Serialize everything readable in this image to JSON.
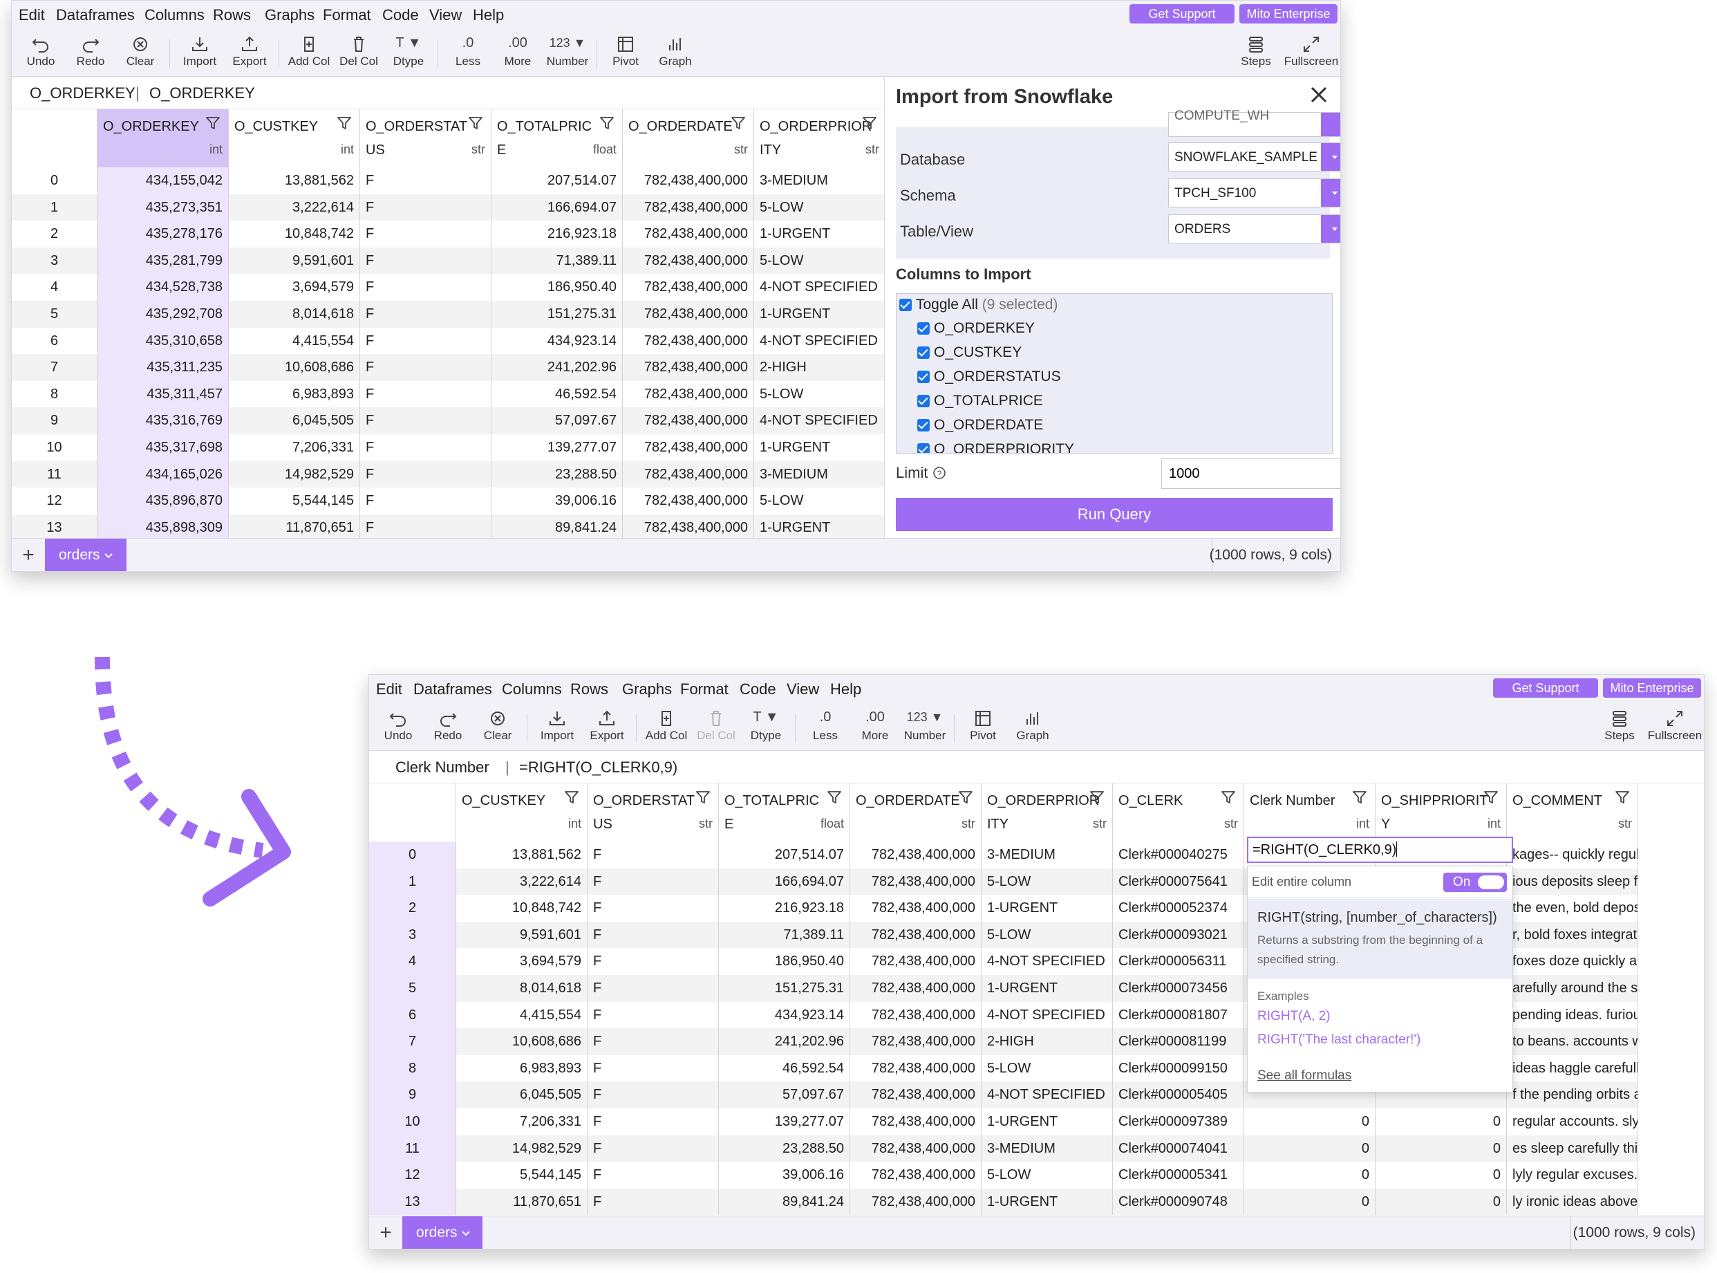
{
  "menu": [
    "Edit",
    "Dataframes",
    "Columns",
    "Rows",
    "Graphs",
    "Format",
    "Code",
    "View",
    "Help"
  ],
  "header_buttons": {
    "support": "Get Support",
    "enterprise": "Mito Enterprise"
  },
  "toolbar": {
    "undo": "Undo",
    "redo": "Redo",
    "clear": "Clear",
    "import": "Import",
    "export": "Export",
    "add_col": "Add Col",
    "del_col": "Del Col",
    "dtype": "Dtype",
    "dtype_glyph": "T ▼",
    "less": "Less",
    "less_glyph": ".0",
    "more": "More",
    "more_glyph": ".00",
    "number": "Number",
    "number_glyph": "123 ▼",
    "pivot": "Pivot",
    "graph": "Graph",
    "steps": "Steps",
    "fullscreen": "Fullscreen"
  },
  "top": {
    "formula_bar": {
      "column": "O_ORDERKEY",
      "separator": "|",
      "value": "O_ORDERKEY"
    },
    "columns": [
      {
        "name": "O_ORDERKEY",
        "type": "int"
      },
      {
        "name": "O_CUSTKEY",
        "type": "int"
      },
      {
        "name": "O_ORDERSTAT",
        "name2": "US",
        "type": "str"
      },
      {
        "name": "O_TOTALPRIC",
        "name2": "E",
        "type": "float"
      },
      {
        "name": "O_ORDERDATE",
        "type": "str"
      },
      {
        "name": "O_ORDERPRIOR",
        "name2": "ITY",
        "type": "str"
      }
    ],
    "rows": [
      [
        "0",
        "434,155,042",
        "13,881,562",
        "F",
        "207,514.07",
        "782,438,400,000",
        "3-MEDIUM"
      ],
      [
        "1",
        "435,273,351",
        "3,222,614",
        "F",
        "166,694.07",
        "782,438,400,000",
        "5-LOW"
      ],
      [
        "2",
        "435,278,176",
        "10,848,742",
        "F",
        "216,923.18",
        "782,438,400,000",
        "1-URGENT"
      ],
      [
        "3",
        "435,281,799",
        "9,591,601",
        "F",
        "71,389.11",
        "782,438,400,000",
        "5-LOW"
      ],
      [
        "4",
        "434,528,738",
        "3,694,579",
        "F",
        "186,950.40",
        "782,438,400,000",
        "4-NOT SPECIFIED"
      ],
      [
        "5",
        "435,292,708",
        "8,014,618",
        "F",
        "151,275.31",
        "782,438,400,000",
        "1-URGENT"
      ],
      [
        "6",
        "435,310,658",
        "4,415,554",
        "F",
        "434,923.14",
        "782,438,400,000",
        "4-NOT SPECIFIED"
      ],
      [
        "7",
        "435,311,235",
        "10,608,686",
        "F",
        "241,202.96",
        "782,438,400,000",
        "2-HIGH"
      ],
      [
        "8",
        "435,311,457",
        "6,983,893",
        "F",
        "46,592.54",
        "782,438,400,000",
        "5-LOW"
      ],
      [
        "9",
        "435,316,769",
        "6,045,505",
        "F",
        "57,097.67",
        "782,438,400,000",
        "4-NOT SPECIFIED"
      ],
      [
        "10",
        "435,317,698",
        "7,206,331",
        "F",
        "139,277.07",
        "782,438,400,000",
        "1-URGENT"
      ],
      [
        "11",
        "434,165,026",
        "14,982,529",
        "F",
        "23,288.50",
        "782,438,400,000",
        "3-MEDIUM"
      ],
      [
        "12",
        "435,896,870",
        "5,544,145",
        "F",
        "39,006.16",
        "782,438,400,000",
        "5-LOW"
      ],
      [
        "13",
        "435,898,309",
        "11,870,651",
        "F",
        "89,841.24",
        "782,438,400,000",
        "1-URGENT"
      ]
    ],
    "taskpane": {
      "title": "Import from Snowflake",
      "warehouse_partial": "COMPUTE_WH",
      "database_label": "Database",
      "database_value": "SNOWFLAKE_SAMPLE_",
      "schema_label": "Schema",
      "schema_value": "TPCH_SF100",
      "table_label": "Table/View",
      "table_value": "ORDERS",
      "columns_heading": "Columns to Import",
      "toggle_all": "Toggle All",
      "selected_count": "(9 selected)",
      "columns": [
        "O_ORDERKEY",
        "O_CUSTKEY",
        "O_ORDERSTATUS",
        "O_TOTALPRICE",
        "O_ORDERDATE",
        "O_ORDERPRIORITY"
      ],
      "limit_label": "Limit",
      "limit_value": "1000",
      "run_button": "Run Query"
    },
    "sheet_tab": "orders",
    "rows_info": "(1000 rows, 9 cols)"
  },
  "bottom": {
    "formula_bar": {
      "column": "Clerk Number",
      "separator": "|",
      "value": "=RIGHT(O_CLERK0,9)"
    },
    "columns": [
      {
        "name": "O_CUSTKEY",
        "type": "int"
      },
      {
        "name": "O_ORDERSTAT",
        "name2": "US",
        "type": "str"
      },
      {
        "name": "O_TOTALPRIC",
        "name2": "E",
        "type": "float"
      },
      {
        "name": "O_ORDERDATE",
        "type": "str"
      },
      {
        "name": "O_ORDERPRIOR",
        "name2": "ITY",
        "type": "str"
      },
      {
        "name": "O_CLERK",
        "type": "str"
      },
      {
        "name": "Clerk Number",
        "type": "int"
      },
      {
        "name": "O_SHIPPRIORIT",
        "name2": "Y",
        "type": "int"
      },
      {
        "name": "O_COMMENT",
        "type": "str"
      }
    ],
    "rows": [
      [
        "0",
        "13,881,562",
        "F",
        "207,514.07",
        "782,438,400,000",
        "3-MEDIUM",
        "Clerk#000040275",
        "",
        "",
        "kages-- quickly regula"
      ],
      [
        "1",
        "3,222,614",
        "F",
        "166,694.07",
        "782,438,400,000",
        "5-LOW",
        "Clerk#000075641",
        "",
        "",
        "ious deposits sleep fu"
      ],
      [
        "2",
        "10,848,742",
        "F",
        "216,923.18",
        "782,438,400,000",
        "1-URGENT",
        "Clerk#000052374",
        "",
        "",
        "the even, bold deposi"
      ],
      [
        "3",
        "9,591,601",
        "F",
        "71,389.11",
        "782,438,400,000",
        "5-LOW",
        "Clerk#000093021",
        "",
        "",
        "r, bold foxes integrate"
      ],
      [
        "4",
        "3,694,579",
        "F",
        "186,950.40",
        "782,438,400,000",
        "4-NOT SPECIFIED",
        "Clerk#000056311",
        "",
        "",
        "foxes doze quickly ac"
      ],
      [
        "5",
        "8,014,618",
        "F",
        "151,275.31",
        "782,438,400,000",
        "1-URGENT",
        "Clerk#000073456",
        "",
        "",
        "arefully around the sl"
      ],
      [
        "6",
        "4,415,554",
        "F",
        "434,923.14",
        "782,438,400,000",
        "4-NOT SPECIFIED",
        "Clerk#000081807",
        "",
        "",
        "pending ideas. furiou"
      ],
      [
        "7",
        "10,608,686",
        "F",
        "241,202.96",
        "782,438,400,000",
        "2-HIGH",
        "Clerk#000081199",
        "",
        "",
        "to beans. accounts w"
      ],
      [
        "8",
        "6,983,893",
        "F",
        "46,592.54",
        "782,438,400,000",
        "5-LOW",
        "Clerk#000099150",
        "",
        "",
        "ideas haggle carefully"
      ],
      [
        "9",
        "6,045,505",
        "F",
        "57,097.67",
        "782,438,400,000",
        "4-NOT SPECIFIED",
        "Clerk#000005405",
        "",
        "",
        "f the pending orbits a"
      ],
      [
        "10",
        "7,206,331",
        "F",
        "139,277.07",
        "782,438,400,000",
        "1-URGENT",
        "Clerk#000097389",
        "0",
        "0",
        "regular accounts. slyl"
      ],
      [
        "11",
        "14,982,529",
        "F",
        "23,288.50",
        "782,438,400,000",
        "3-MEDIUM",
        "Clerk#000074041",
        "0",
        "0",
        "es sleep carefully thir"
      ],
      [
        "12",
        "5,544,145",
        "F",
        "39,006.16",
        "782,438,400,000",
        "5-LOW",
        "Clerk#000005341",
        "0",
        "0",
        "lyly regular excuses. t"
      ],
      [
        "13",
        "11,870,651",
        "F",
        "89,841.24",
        "782,438,400,000",
        "1-URGENT",
        "Clerk#000090748",
        "0",
        "0",
        "ly ironic ideas above t"
      ]
    ],
    "popup": {
      "editor_value": "=RIGHT(O_CLERK0,9)",
      "edit_entire_column": "Edit entire column",
      "toggle": "On",
      "signature": "RIGHT(string, [number_of_characters])",
      "description": "Returns a substring from the beginning of a specified string.",
      "examples_heading": "Examples",
      "examples": [
        "RIGHT(A, 2)",
        "RIGHT('The last character!')"
      ],
      "see_all": "See all formulas"
    },
    "sheet_tab": "orders",
    "rows_info": "(1000 rows, 9 cols)"
  },
  "colors": {
    "accent": "#9d6cf3",
    "toolbar_bg": "#f1f1f7",
    "selected_header": "#d4c3f7",
    "checkbox": "#1a73e8"
  }
}
